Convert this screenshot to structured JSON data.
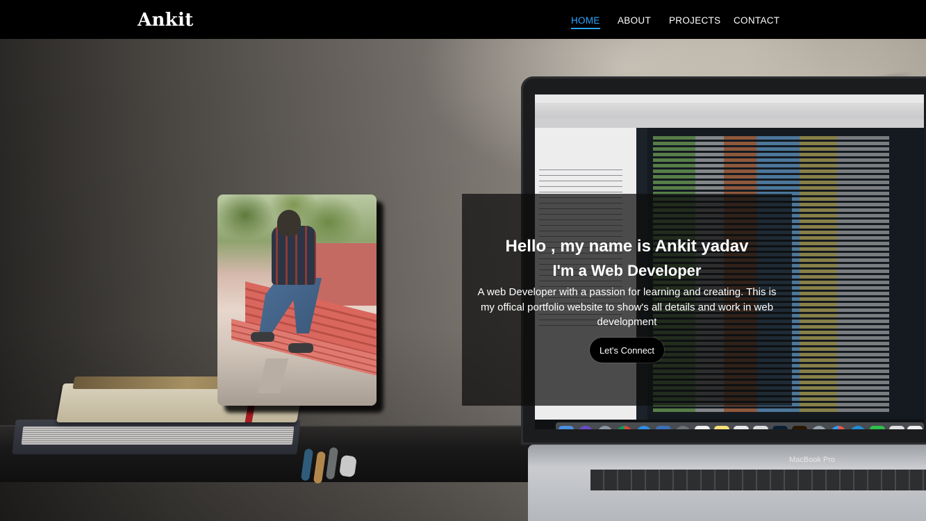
{
  "navbar": {
    "brand": "Ankit",
    "links": [
      {
        "label": "HOME",
        "active": true
      },
      {
        "label": "ABOUT",
        "active": false
      },
      {
        "label": "PROJECTS",
        "active": false
      },
      {
        "label": "CONTACT",
        "active": false
      }
    ],
    "active_color": "#2aa7ff"
  },
  "hero": {
    "heading": "Hello , my name is Ankit yadav",
    "subheading": "I'm a Web Developer",
    "description": "A web Developer with a passion for learning and creating. This is my offical portfolio website to show's all details and work in web development",
    "button_label": "Let's Connect",
    "laptop_label": "MacBook Pro"
  },
  "colors": {
    "navbar_bg": "#000000",
    "card_bg": "rgba(12,12,12,0.72)",
    "text": "#ffffff",
    "accent": "#2aa7ff"
  }
}
